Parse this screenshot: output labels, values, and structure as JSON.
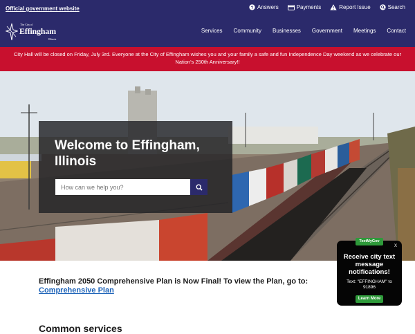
{
  "header": {
    "official_link": "Official government website",
    "utilities": [
      {
        "label": "Answers",
        "icon": "question-circle-icon"
      },
      {
        "label": "Payments",
        "icon": "card-icon"
      },
      {
        "label": "Report Issue",
        "icon": "warning-icon"
      },
      {
        "label": "Search",
        "icon": "search-icon"
      }
    ],
    "logo": {
      "small": "The City of",
      "name": "Effingham",
      "state": "Illinois"
    },
    "nav": [
      "Services",
      "Community",
      "Businesses",
      "Government",
      "Meetings",
      "Contact"
    ]
  },
  "alert": {
    "text": "City Hall will be closed on Friday, July 3rd.  Everyone at the City of Effingham wishes you and your family a safe and fun Independence Day weekend as we celebrate our Nation's 250th Anniversary!!"
  },
  "hero": {
    "title": "Welcome to Effingham, Illinois",
    "search_placeholder": "How can we help you?"
  },
  "notice": {
    "text": "Effingham 2050 Comprehensive Plan is Now Final!  To view the Plan, go to: ",
    "link_text": "Comprehensive Plan"
  },
  "sections": {
    "common_services": "Common services"
  },
  "textmygov": {
    "brand": "TextMyGov",
    "close": "x",
    "heading": "Receive city text message notifications!",
    "text": "Text: \"EFFINGHAM\" to 91896",
    "button": "Learn More"
  },
  "colors": {
    "navy": "#2b2a6b",
    "alert_red": "#c8102e",
    "link_blue": "#1d63b8",
    "tmg_green": "#2e9a3a"
  }
}
